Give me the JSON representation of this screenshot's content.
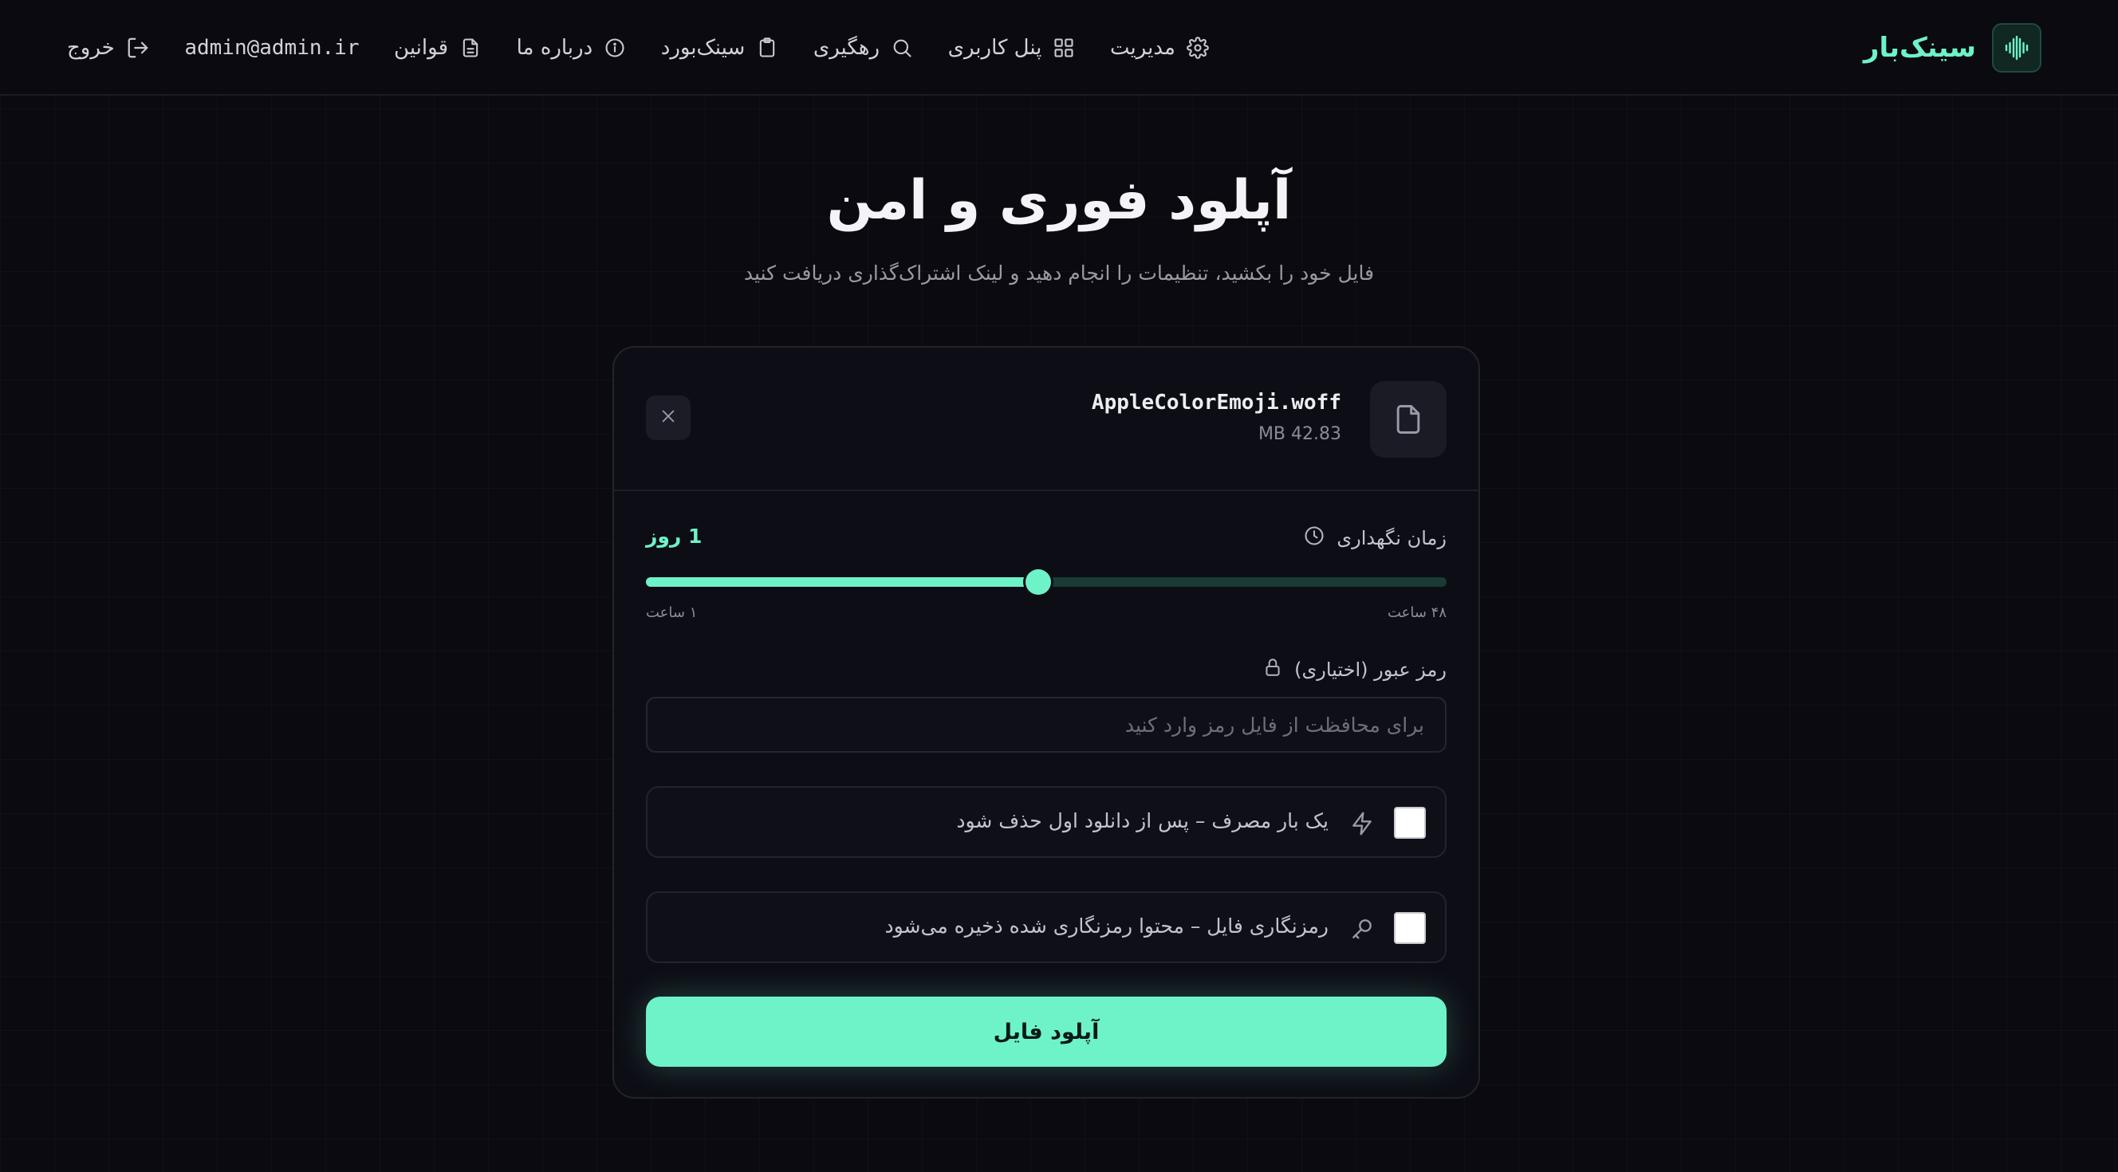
{
  "header": {
    "brand": "سینک‌بار",
    "brand_icon": "audio-waveform-icon",
    "nav": {
      "admin": "مدیریت",
      "panel": "پنل کاربری",
      "track": "رهگیری",
      "clipboard": "سینک‌بورد",
      "about": "درباره ما",
      "rules": "قوانین",
      "email": "admin@admin.ir",
      "logout": "خروج"
    }
  },
  "hero": {
    "title": "آپلود فوری و امن",
    "subtitle": "فایل خود را بکشید، تنظیمات را انجام دهید و لینک اشتراک‌گذاری دریافت کنید"
  },
  "file": {
    "name": "AppleColorEmoji.woff",
    "size": "42.83 MB"
  },
  "retention": {
    "label": "زمان نگهداری",
    "value": "1 روز",
    "min_label": "۱ ساعت",
    "max_label": "۴۸ ساعت",
    "fraction": 0.49
  },
  "password": {
    "label": "رمز عبور (اختیاری)",
    "placeholder": "برای محافظت از فایل رمز وارد کنید",
    "value": ""
  },
  "options": {
    "one_time": "یک بار مصرف – پس از دانلود اول حذف شود",
    "encrypt": "رمزنگاری فایل – محتوا رمزنگاری شده ذخیره می‌شود"
  },
  "upload_button": "آپلود فایل",
  "colors": {
    "accent": "#6ef2c7",
    "background": "#0a0a10",
    "card": "#0d0d15"
  }
}
